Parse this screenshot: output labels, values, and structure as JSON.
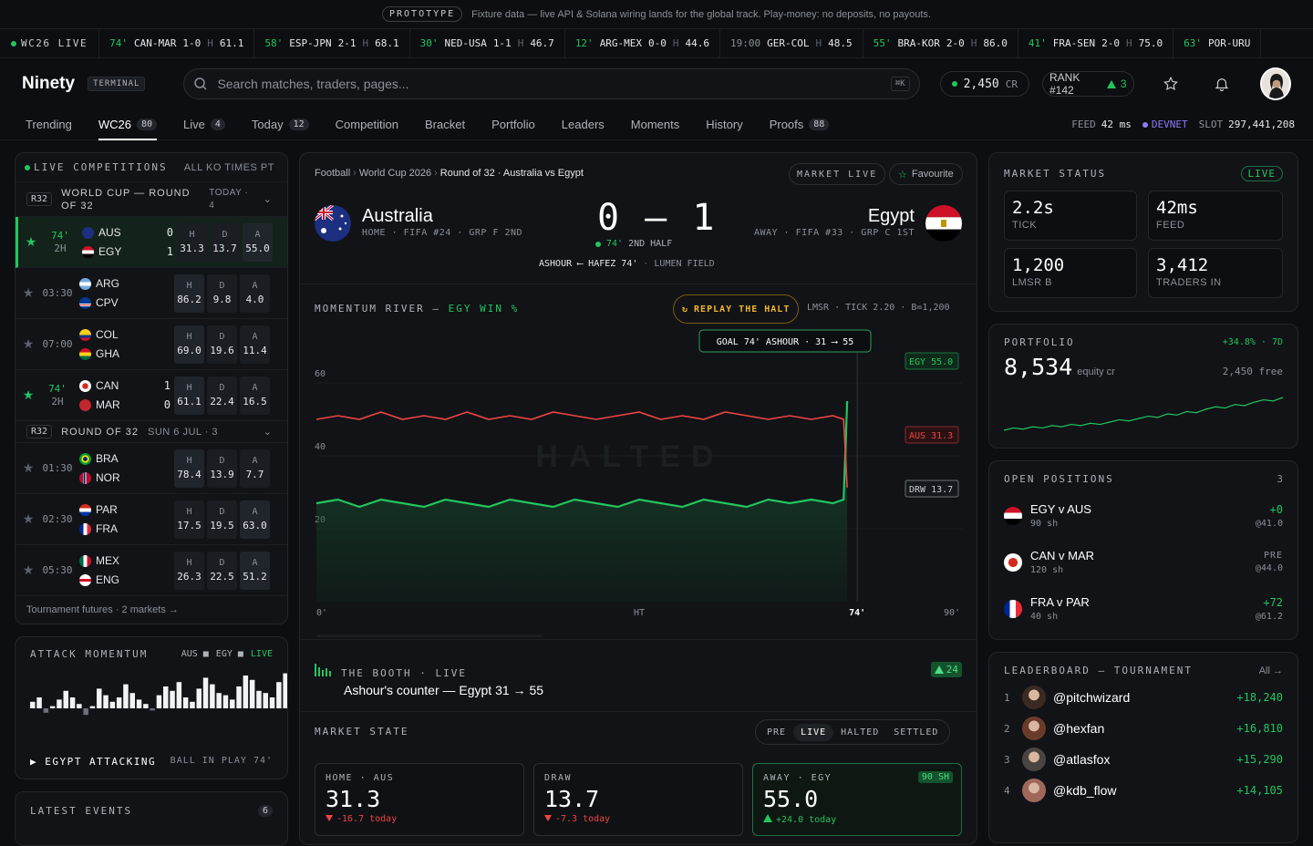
{
  "banner": {
    "tag": "PROTOTYPE",
    "text": "Fixture data — live API & Solana wiring lands for the global track. Play-money: no deposits, no payouts."
  },
  "ticker": {
    "label": "WC26 LIVE",
    "items": [
      {
        "min": "74'",
        "match": "CAN-MAR",
        "score": "1-0",
        "h": "H",
        "odds": "61.1"
      },
      {
        "min": "58'",
        "match": "ESP-JPN",
        "score": "2-1",
        "h": "H",
        "odds": "68.1"
      },
      {
        "min": "30'",
        "match": "NED-USA",
        "score": "1-1",
        "h": "H",
        "odds": "46.7"
      },
      {
        "min": "12'",
        "match": "ARG-MEX",
        "score": "0-0",
        "h": "H",
        "odds": "44.6"
      },
      {
        "min": "19:00",
        "match": "GER-COL",
        "score": "",
        "h": "H",
        "odds": "48.5",
        "pre": true
      },
      {
        "min": "55'",
        "match": "BRA-KOR",
        "score": "2-0",
        "h": "H",
        "odds": "86.0"
      },
      {
        "min": "41'",
        "match": "FRA-SEN",
        "score": "2-0",
        "h": "H",
        "odds": "75.0"
      },
      {
        "min": "63'",
        "match": "POR-URU",
        "score": "",
        "h": "",
        "odds": ""
      }
    ]
  },
  "header": {
    "logo": "Ninety",
    "logo_badge": "TERMINAL",
    "search_placeholder": "Search matches, traders, pages...",
    "search_kbd": "⌘K",
    "credits": "2,450",
    "credits_unit": "CR",
    "rank_label": "RANK #142",
    "rank_delta": "3"
  },
  "nav": {
    "items": [
      {
        "label": "Trending",
        "badge": ""
      },
      {
        "label": "WC26",
        "badge": "80",
        "active": true
      },
      {
        "label": "Live",
        "badge": "4"
      },
      {
        "label": "Today",
        "badge": "12"
      },
      {
        "label": "Competition",
        "badge": ""
      },
      {
        "label": "Bracket",
        "badge": ""
      },
      {
        "label": "Portfolio",
        "badge": ""
      },
      {
        "label": "Leaders",
        "badge": ""
      },
      {
        "label": "Moments",
        "badge": ""
      },
      {
        "label": "History",
        "badge": ""
      },
      {
        "label": "Proofs",
        "badge": "88"
      }
    ],
    "feed_label": "FEED",
    "feed_value": "42 ms",
    "network": "DEVNET",
    "slot_label": "SLOT",
    "slot_value": "297,441,208"
  },
  "competitions": {
    "title": "LIVE COMPETITIONS",
    "right": "ALL KO TIMES PT",
    "group1": {
      "tag": "R32",
      "name": "WORLD CUP — ROUND OF 32",
      "when": "TODAY · 4"
    },
    "group2": {
      "tag": "R32",
      "name": "ROUND OF 32",
      "when": "SUN 6 JUL · 3"
    },
    "matches": [
      {
        "starred": true,
        "live": true,
        "time": "74'",
        "sub": "2H",
        "home": "AUS",
        "away": "EGY",
        "hs": "0",
        "as": "1",
        "h": "31.3",
        "d": "13.7",
        "a": "55.0",
        "hlA": true
      },
      {
        "starred": false,
        "live": false,
        "time": "03:30",
        "sub": "",
        "home": "ARG",
        "away": "CPV",
        "hs": "",
        "as": "",
        "h": "86.2",
        "d": "9.8",
        "a": "4.0",
        "hlH": true
      },
      {
        "starred": false,
        "live": false,
        "time": "07:00",
        "sub": "",
        "home": "COL",
        "away": "GHA",
        "hs": "",
        "as": "",
        "h": "69.0",
        "d": "19.6",
        "a": "11.4",
        "hlH": true
      },
      {
        "starred": true,
        "live": true,
        "time": "74'",
        "sub": "2H",
        "home": "CAN",
        "away": "MAR",
        "hs": "1",
        "as": "0",
        "h": "61.1",
        "d": "22.4",
        "a": "16.5",
        "hlH": true
      },
      {
        "starred": false,
        "live": false,
        "time": "01:30",
        "sub": "",
        "home": "BRA",
        "away": "NOR",
        "hs": "",
        "as": "",
        "h": "78.4",
        "d": "13.9",
        "a": "7.7",
        "hlH": true
      },
      {
        "starred": false,
        "live": false,
        "time": "02:30",
        "sub": "",
        "home": "PAR",
        "away": "FRA",
        "hs": "",
        "as": "",
        "h": "17.5",
        "d": "19.5",
        "a": "63.0",
        "hlA": true
      },
      {
        "starred": false,
        "live": false,
        "time": "05:30",
        "sub": "",
        "home": "MEX",
        "away": "ENG",
        "hs": "",
        "as": "",
        "h": "26.3",
        "d": "22.5",
        "a": "51.2",
        "hlA": true
      }
    ],
    "footer": "Tournament futures · 2 markets →"
  },
  "attack": {
    "title": "ATTACK MOMENTUM",
    "legend_aus": "AUS ■",
    "legend_egy": "EGY ■",
    "live": "LIVE",
    "bars": [
      3,
      5,
      -2,
      1,
      4,
      8,
      5,
      2,
      -3,
      1,
      9,
      6,
      3,
      5,
      11,
      7,
      4,
      2,
      -1,
      6,
      10,
      8,
      12,
      5,
      3,
      9,
      14,
      11,
      7,
      6,
      4,
      10,
      15,
      13,
      8,
      7,
      5,
      12,
      16,
      18
    ],
    "status": "EGYPT ATTACKING",
    "ball": "BALL IN PLAY 74'"
  },
  "events": {
    "title": "LATEST EVENTS",
    "count": "6"
  },
  "match": {
    "crumbs": [
      "Football",
      "World Cup 2026",
      "Round of 32 · Australia vs Egypt"
    ],
    "market_live": "MARKET LIVE",
    "favourite": "Favourite",
    "home": "Australia",
    "home_meta": "HOME · FIFA #24 · GRP F 2ND",
    "away": "Egypt",
    "away_meta": "AWAY · FIFA #33 · GRP C 1ST",
    "score": "0 – 1",
    "minute": "74'",
    "half": "2ND HALF",
    "scorer": "ASHOUR ⟵ HAFEZ 74'",
    "venue": "LUMEN FIELD"
  },
  "momentum": {
    "title": "MOMENTUM RIVER — ",
    "title_accent": "EGY WIN %",
    "replay": "REPLAY THE HALT",
    "meta": "LMSR · TICK 2.20 · B=1,200",
    "goal_label": "GOAL 74' ASHOUR · 31 ⟶ 55",
    "watermark": "HALTED",
    "y_ticks": [
      "60",
      "40",
      "20"
    ],
    "x_ticks": [
      "0'",
      "HT",
      "74'",
      "90'"
    ],
    "tag_egy": "EGY 55.0",
    "tag_aus": "AUS 31.3",
    "tag_drw": "DRW 13.7"
  },
  "chart_data": {
    "type": "area",
    "title": "MOMENTUM RIVER — EGY WIN %",
    "xlabel": "",
    "ylabel": "",
    "xlim": [
      0,
      90
    ],
    "ylim": [
      0,
      75
    ],
    "x_ticks": [
      "0'",
      "HT",
      "74'",
      "90'"
    ],
    "series": [
      {
        "name": "EGY",
        "x": [
          0,
          3,
          6,
          9,
          12,
          15,
          18,
          21,
          24,
          27,
          30,
          33,
          36,
          39,
          42,
          45,
          48,
          51,
          54,
          57,
          60,
          63,
          66,
          69,
          72,
          73.5,
          74
        ],
        "values": [
          27,
          28,
          26,
          28,
          27,
          26,
          28,
          27,
          26,
          28,
          27,
          26,
          28,
          27,
          26,
          28,
          27,
          26,
          28,
          27,
          26,
          28,
          27,
          28,
          27,
          28,
          55
        ]
      },
      {
        "name": "AUS",
        "x": [
          0,
          3,
          6,
          9,
          12,
          15,
          18,
          21,
          24,
          27,
          30,
          33,
          36,
          39,
          42,
          45,
          48,
          51,
          54,
          57,
          60,
          63,
          66,
          69,
          72,
          73.5,
          74
        ],
        "values": [
          50,
          51,
          50,
          52,
          50,
          51,
          50,
          52,
          50,
          51,
          50,
          52,
          51,
          50,
          51,
          52,
          50,
          51,
          50,
          52,
          51,
          50,
          51,
          50,
          51,
          50,
          31.3
        ]
      }
    ],
    "annotation": "GOAL 74' ASHOUR · 31 ⟶ 55"
  },
  "booth": {
    "title": "THE BOOTH · LIVE",
    "text": "Ashour's counter — Egypt 31 → 55",
    "votes": "24"
  },
  "market_state": {
    "title": "MARKET STATE",
    "states": [
      "PRE",
      "LIVE",
      "HALTED",
      "SETTLED"
    ],
    "active": "LIVE",
    "cards": [
      {
        "label": "HOME · AUS",
        "value": "31.3",
        "change": "-16.7 today",
        "dir": "down"
      },
      {
        "label": "DRAW",
        "value": "13.7",
        "change": "-7.3 today",
        "dir": "down"
      },
      {
        "label": "AWAY · EGY",
        "value": "55.0",
        "change": "+24.0 today",
        "dir": "up",
        "badge": "90 SH"
      }
    ]
  },
  "market_status": {
    "title": "MARKET STATUS",
    "badge": "LIVE",
    "stats": [
      {
        "value": "2.2s",
        "label": "TICK"
      },
      {
        "value": "42ms",
        "label": "FEED"
      },
      {
        "value": "1,200",
        "label": "LMSR B"
      },
      {
        "value": "3,412",
        "label": "TRADERS IN"
      }
    ]
  },
  "portfolio": {
    "title": "PORTFOLIO",
    "change": "+34.8% · 7D",
    "value": "8,534",
    "unit": "equity cr",
    "free": "2,450 free",
    "spark": [
      10,
      12,
      11,
      13,
      12,
      14,
      13,
      15,
      14,
      16,
      15,
      17,
      19,
      18,
      20,
      22,
      21,
      24,
      23,
      26,
      25,
      28,
      30,
      29,
      32,
      31,
      34,
      36,
      35,
      38
    ]
  },
  "positions": {
    "title": "OPEN POSITIONS",
    "count": "3",
    "items": [
      {
        "name": "EGY v AUS",
        "shares": "90 sh",
        "pnl": "+0",
        "price": "@41.0",
        "flag": "egy"
      },
      {
        "name": "CAN v MAR",
        "shares": "120 sh",
        "pnl": "PRE",
        "price": "@44.0",
        "flag": "can"
      },
      {
        "name": "FRA v PAR",
        "shares": "40 sh",
        "pnl": "+72",
        "price": "@61.2",
        "flag": "fra"
      }
    ]
  },
  "leaderboard": {
    "title": "LEADERBOARD — TOURNAMENT",
    "filter": "All →",
    "items": [
      {
        "rank": "1",
        "handle": "@pitchwizard",
        "pts": "+18,240"
      },
      {
        "rank": "2",
        "handle": "@hexfan",
        "pts": "+16,810"
      },
      {
        "rank": "3",
        "handle": "@atlasfox",
        "pts": "+15,290"
      },
      {
        "rank": "4",
        "handle": "@kdb_flow",
        "pts": "+14,105"
      }
    ]
  },
  "colors": {
    "accent": "#22c55e",
    "negative": "#ef4444",
    "warning": "#f0b429",
    "network": "#8b7cf6"
  }
}
